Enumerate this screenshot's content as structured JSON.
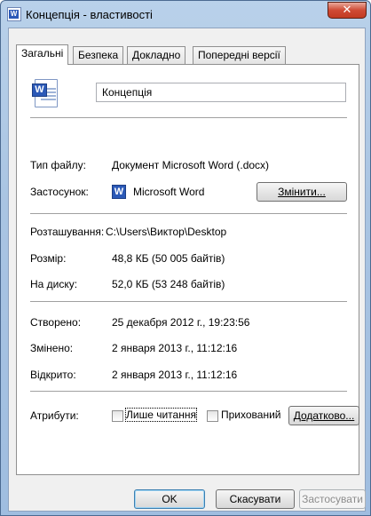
{
  "window": {
    "title": "Концепція - властивості",
    "close_glyph": "✕"
  },
  "tabs": [
    {
      "label": "Загальні",
      "active": true
    },
    {
      "label": "Безпека",
      "active": false
    },
    {
      "label": "Докладно",
      "active": false
    },
    {
      "label": "Попередні версії",
      "active": false
    }
  ],
  "general": {
    "icon_letter": "W",
    "file_name": "Концепція",
    "file_type_label": "Тип файлу:",
    "file_type_value": "Документ Microsoft Word (.docx)",
    "app_label": "Застосунок:",
    "app_icon_letter": "W",
    "app_value": "Microsoft Word",
    "change_button": "Змінити...",
    "location_label": "Розташування:",
    "location_value": "C:\\Users\\Виктор\\Desktop",
    "size_label": "Розмір:",
    "size_value": "48,8 КБ (50 005 байтів)",
    "disk_label": "На диску:",
    "disk_value": "52,0 КБ (53 248 байтів)",
    "created_label": "Створено:",
    "created_value": "25 декабря 2012 г., 19:23:56",
    "modified_label": "Змінено:",
    "modified_value": "2 января 2013 г., 11:12:16",
    "accessed_label": "Відкрито:",
    "accessed_value": "2 января 2013 г., 11:12:16",
    "attributes_label": "Атрибути:",
    "readonly_label": "Лише читання",
    "readonly_checked": false,
    "hidden_label": "Прихований",
    "hidden_checked": false,
    "advanced_button": "Додатково..."
  },
  "footer": {
    "ok": "OK",
    "cancel": "Скасувати",
    "apply": "Застосувати"
  },
  "colors": {
    "title_bar": "#a9c4e2",
    "close_button": "#cf4a34",
    "word_blue": "#2b59b7",
    "focus_border": "#3c7fb1"
  }
}
